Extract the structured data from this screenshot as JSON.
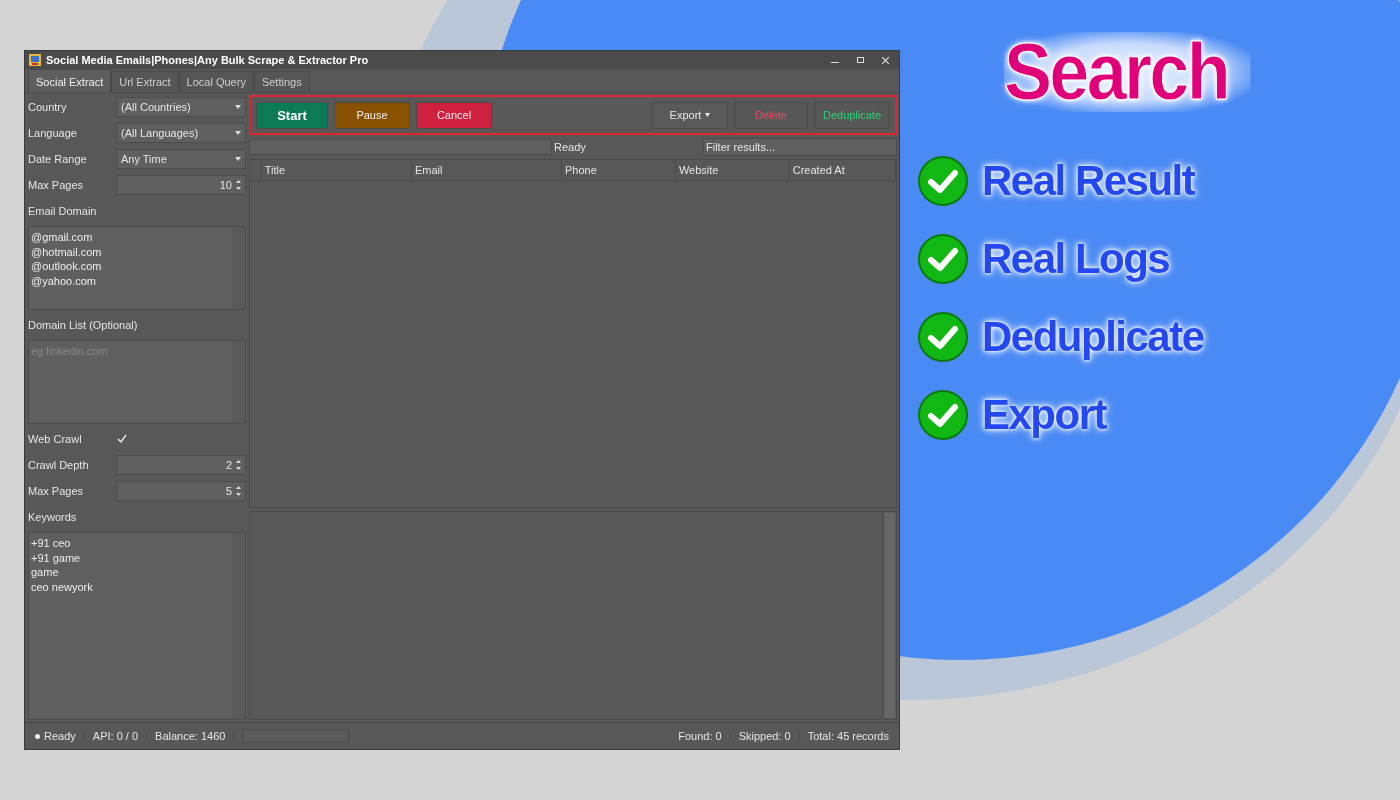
{
  "window": {
    "title": "Social Media Emails|Phones|Any Bulk Scrape & Extractor Pro"
  },
  "tabs": [
    {
      "label": "Social Extract",
      "selected": true
    },
    {
      "label": "Url Extract",
      "selected": false
    },
    {
      "label": "Local Query",
      "selected": false
    },
    {
      "label": "Settings",
      "selected": false
    }
  ],
  "form": {
    "fields": [
      {
        "kind": "select",
        "label": "Country",
        "value": "(All Countries)"
      },
      {
        "kind": "select",
        "label": "Language",
        "value": "(All Languages)"
      },
      {
        "kind": "select",
        "label": "Date Range",
        "value": "Any Time"
      },
      {
        "kind": "spin",
        "label": "Max Pages",
        "value": "10"
      },
      {
        "kind": "textarea",
        "label": "Email Domain",
        "lines": [
          "@gmail.com",
          "@hotmail.com",
          "@outlook.com",
          "@yahoo.com"
        ]
      },
      {
        "kind": "textarea",
        "label": "Domain List (Optional)",
        "placeholder": "eg:linkedin.com"
      },
      {
        "kind": "checkbox",
        "label": "Web Crawl",
        "checked": true
      },
      {
        "kind": "spin",
        "label": "Crawl Depth",
        "value": "2"
      },
      {
        "kind": "spin",
        "label": "Max Pages",
        "value": "5"
      },
      {
        "kind": "textarea",
        "label": "Keywords",
        "lines": [
          "+91 ceo",
          "+91 game",
          "game",
          "ceo newyork"
        ]
      }
    ]
  },
  "toolbar": {
    "buttons": [
      {
        "label": "Start",
        "kind": "start"
      },
      {
        "label": "Pause",
        "kind": "pause"
      },
      {
        "label": "Cancel",
        "kind": "cancel"
      },
      {
        "label": "Export",
        "kind": "menu"
      },
      {
        "label": "Delete",
        "kind": "delete"
      },
      {
        "label": "Deduplicate",
        "kind": "dedupe"
      }
    ]
  },
  "progress": {
    "status": "Ready",
    "level": 0
  },
  "filter": {
    "placeholder": "Filter results..."
  },
  "table": {
    "columns": [
      "Title",
      "Email",
      "Phone",
      "Website",
      "Created At"
    ]
  },
  "status_bar": {
    "left": [
      "Ready",
      "API: 0 / 0",
      "Balance: 1460"
    ],
    "progress": {
      "level": 0
    },
    "right": [
      "Found: 0",
      "Skipped: 0",
      "Total: 45 records"
    ]
  },
  "promo": {
    "title": "Search",
    "features": [
      "Real Result",
      "Real Logs",
      "Deduplicate",
      "Export"
    ]
  }
}
